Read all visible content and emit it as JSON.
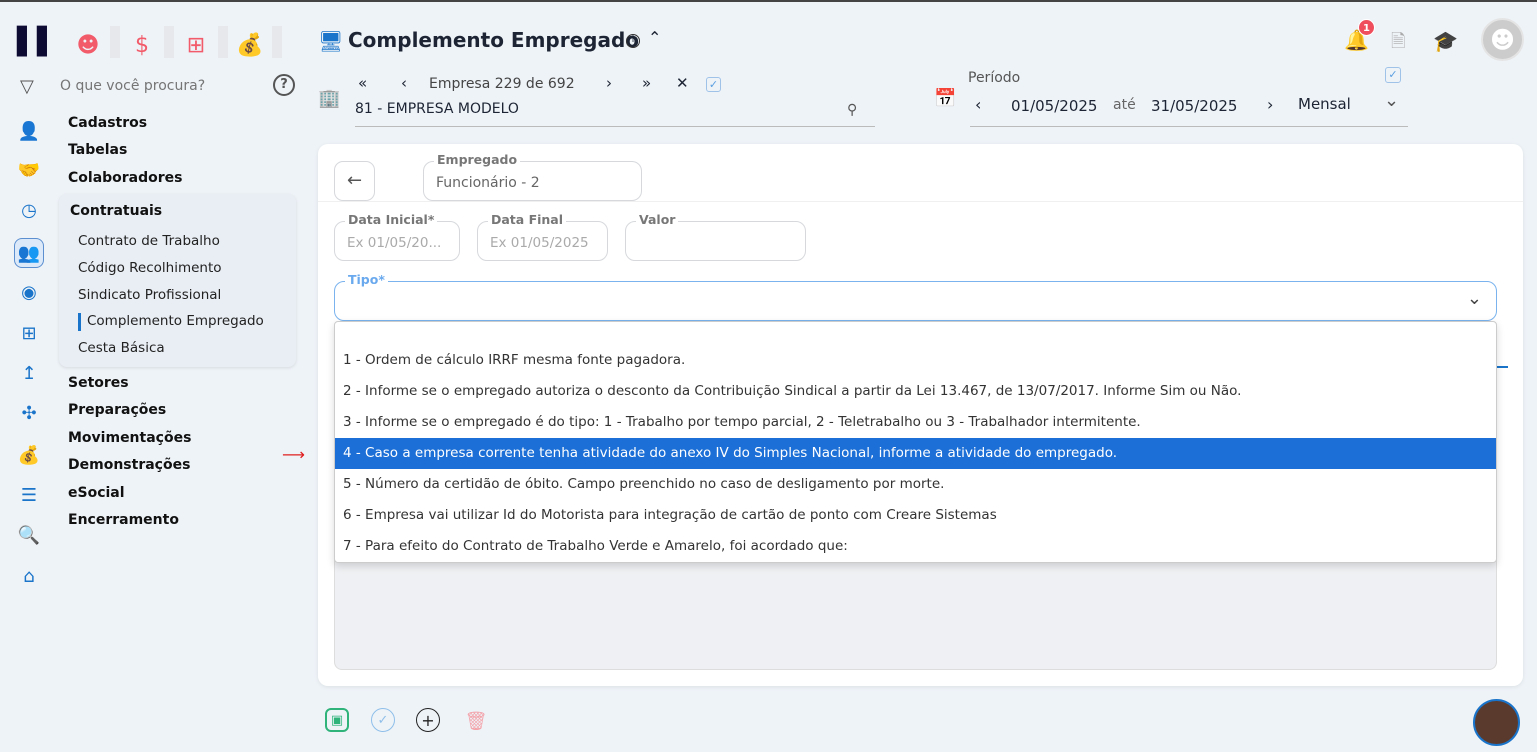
{
  "search": {
    "placeholder": "O que você procura?"
  },
  "menu": [
    "Cadastros",
    "Tabelas",
    "Colaboradores"
  ],
  "group": {
    "title": "Contratuais",
    "items": [
      "Contrato de Trabalho",
      "Código Recolhimento",
      "Sindicato Profissional",
      "Complemento Empregado",
      "Cesta Básica"
    ]
  },
  "menu2": [
    "Setores",
    "Preparações",
    "Movimentações",
    "Demonstrações",
    "eSocial",
    "Encerramento"
  ],
  "header": {
    "title": "Complemento Empregado",
    "company_nav": "Empresa 229 de 692",
    "company": "81 - EMPRESA MODELO",
    "period_label": "Período",
    "date_from": "01/05/2025",
    "until": "até",
    "date_to": "31/05/2025",
    "periodicity": "Mensal",
    "notifications": "1"
  },
  "form": {
    "employee_label": "Empregado",
    "employee_value": "Funcionário - 2",
    "start_label": "Data Inicial*",
    "start_placeholder": "Ex 01/05/20...",
    "end_label": "Data Final",
    "end_placeholder": "Ex 01/05/2025",
    "value_label": "Valor",
    "type_label": "Tipo*",
    "options": [
      "1 - Ordem de cálculo IRRF mesma fonte pagadora.",
      "2 - Informe se o empregado autoriza o desconto da Contribuição Sindical a partir da Lei 13.467, de 13/07/2017. Informe Sim ou Não.",
      "3 - Informe se o empregado é do tipo: 1 - Trabalho por tempo parcial, 2 - Teletrabalho ou 3 - Trabalhador intermitente.",
      "4 - Caso a empresa corrente tenha atividade do anexo IV do Simples Nacional, informe a atividade do empregado.",
      "5 - Número da certidão de óbito. Campo preenchido no caso de desligamento por morte.",
      "6 - Empresa vai utilizar Id do Motorista para integração de cartão de ponto com Creare Sistemas",
      "7 - Para efeito do Contrato de Trabalho Verde e Amarelo, foi acordado que:"
    ],
    "selected_index": 3
  }
}
